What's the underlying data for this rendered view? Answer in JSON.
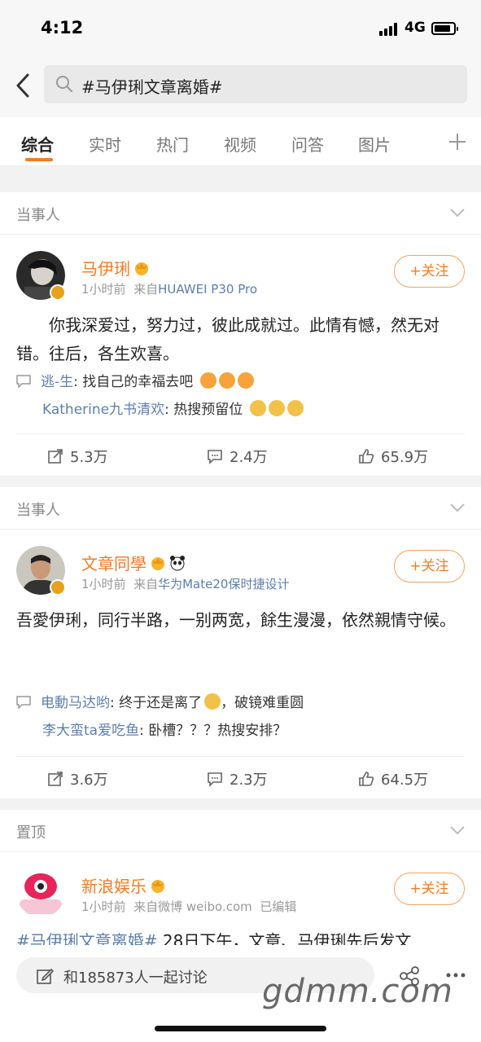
{
  "status_bar": {
    "time": "4:12",
    "network": "4G"
  },
  "search": {
    "query": "#马伊琍文章离婚#"
  },
  "tabs": [
    {
      "label": "综合"
    },
    {
      "label": "实时"
    },
    {
      "label": "热门"
    },
    {
      "label": "视频"
    },
    {
      "label": "问答"
    },
    {
      "label": "图片"
    }
  ],
  "colors": {
    "accent": "#f57a22",
    "link": "#5b7fad",
    "verify": "#e8a21a"
  },
  "sections": [
    {
      "title": "当事人",
      "post": {
        "author": "马伊琍",
        "time": "1小时前",
        "source_prefix": "来自",
        "source": "HUAWEI P30 Pro",
        "follow_label": "+关注",
        "content": "　　你我深爱过，努力过，彼此成就过。此情有憾，然无对错。往后，各生欢喜。",
        "comments": [
          {
            "user": "逃-生",
            "sep": ": ",
            "text": "找自己的幸福去吧"
          },
          {
            "user": "Katherine九书清欢",
            "sep": ": ",
            "text": "热搜预留位"
          }
        ],
        "reposts": "5.3万",
        "comment_count": "2.4万",
        "likes": "65.9万"
      }
    },
    {
      "title": "当事人",
      "post": {
        "author": "文章同學",
        "time": "1小时前",
        "source_prefix": "来自",
        "source": "华为Mate20保时捷设计",
        "follow_label": "+关注",
        "content": "吾愛伊琍，同行半路，一别两宽，餘生漫漫，依然親情守候。",
        "comments": [
          {
            "user": "电動马达哟",
            "sep": ": ",
            "text": "终于还是离了",
            "text2": "，破镜难重圆"
          },
          {
            "user": "李大蛮ta爱吃鱼",
            "sep": ": ",
            "text": "卧槽？？？热搜安排？"
          }
        ],
        "reposts": "3.6万",
        "comment_count": "2.3万",
        "likes": "64.5万"
      }
    },
    {
      "title": "置顶",
      "post": {
        "author": "新浪娱乐",
        "time": "1小时前",
        "source_prefix": "来自微博 weibo.com",
        "edited": "已编辑",
        "follow_label": "+关注",
        "hashtag": "#马伊琍文章离婚#",
        "content": " 28日下午，文章、马伊琍先后发文"
      }
    }
  ],
  "bottom": {
    "discuss": "和185873人一起讨论"
  },
  "watermark": "gdmm.com"
}
